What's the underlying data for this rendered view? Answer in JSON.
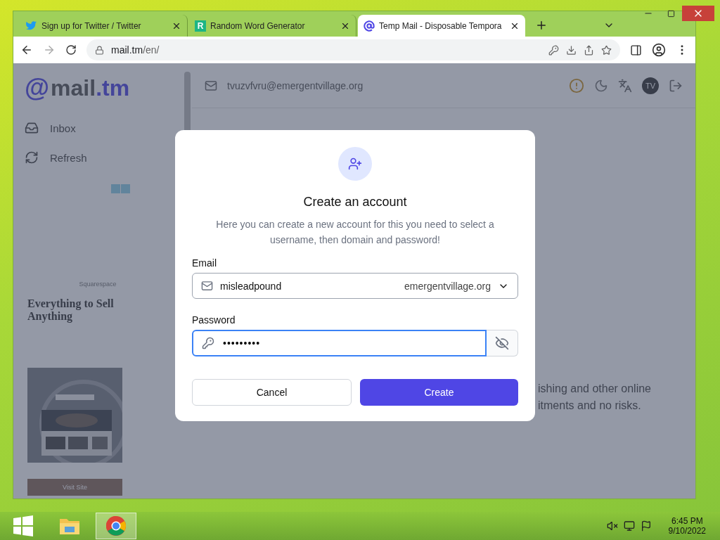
{
  "browser": {
    "tabs": [
      {
        "title": "Sign up for Twitter / Twitter",
        "selected": false,
        "kind": "bird"
      },
      {
        "title": "Random Word Generator",
        "selected": false,
        "kind": "letter",
        "letter": "R"
      },
      {
        "title": "Temp Mail - Disposable Tempora",
        "selected": true,
        "kind": "at"
      }
    ],
    "address": {
      "host": "mail.tm",
      "path": "/en/"
    }
  },
  "page": {
    "logo": {
      "symbol": "@",
      "name": "mail",
      "suffix": ".tm"
    },
    "nav": [
      {
        "label": "Inbox",
        "kind": "inbox"
      },
      {
        "label": "Refresh",
        "kind": "refresh"
      }
    ],
    "ad": {
      "sponsor": "Squarespace",
      "headline": "Everything to Sell Anything",
      "button": "Visit Site"
    },
    "account": {
      "email": "tvuzvfvru@emergentvillage.org",
      "avatar": "TV"
    },
    "intro": [
      "ishing and other online",
      "itments and no risks."
    ]
  },
  "dialog": {
    "title": "Create an account",
    "description": "Here you can create a new account for this you need to select a username, then domain and password!",
    "email_label": "Email",
    "username": "misleadpound",
    "domain": "emergentvillage.org",
    "password_label": "Password",
    "password": "•••••••••",
    "password_focused": true,
    "buttons": [
      {
        "label": "Cancel",
        "kind": "secondary"
      },
      {
        "label": "Create",
        "kind": "primary"
      }
    ]
  },
  "taskbar": {
    "apps": [
      {
        "kind": "explorer",
        "selected": false
      },
      {
        "kind": "chrome",
        "selected": true
      }
    ],
    "time": "6:45 PM",
    "date": "9/10/2022"
  }
}
